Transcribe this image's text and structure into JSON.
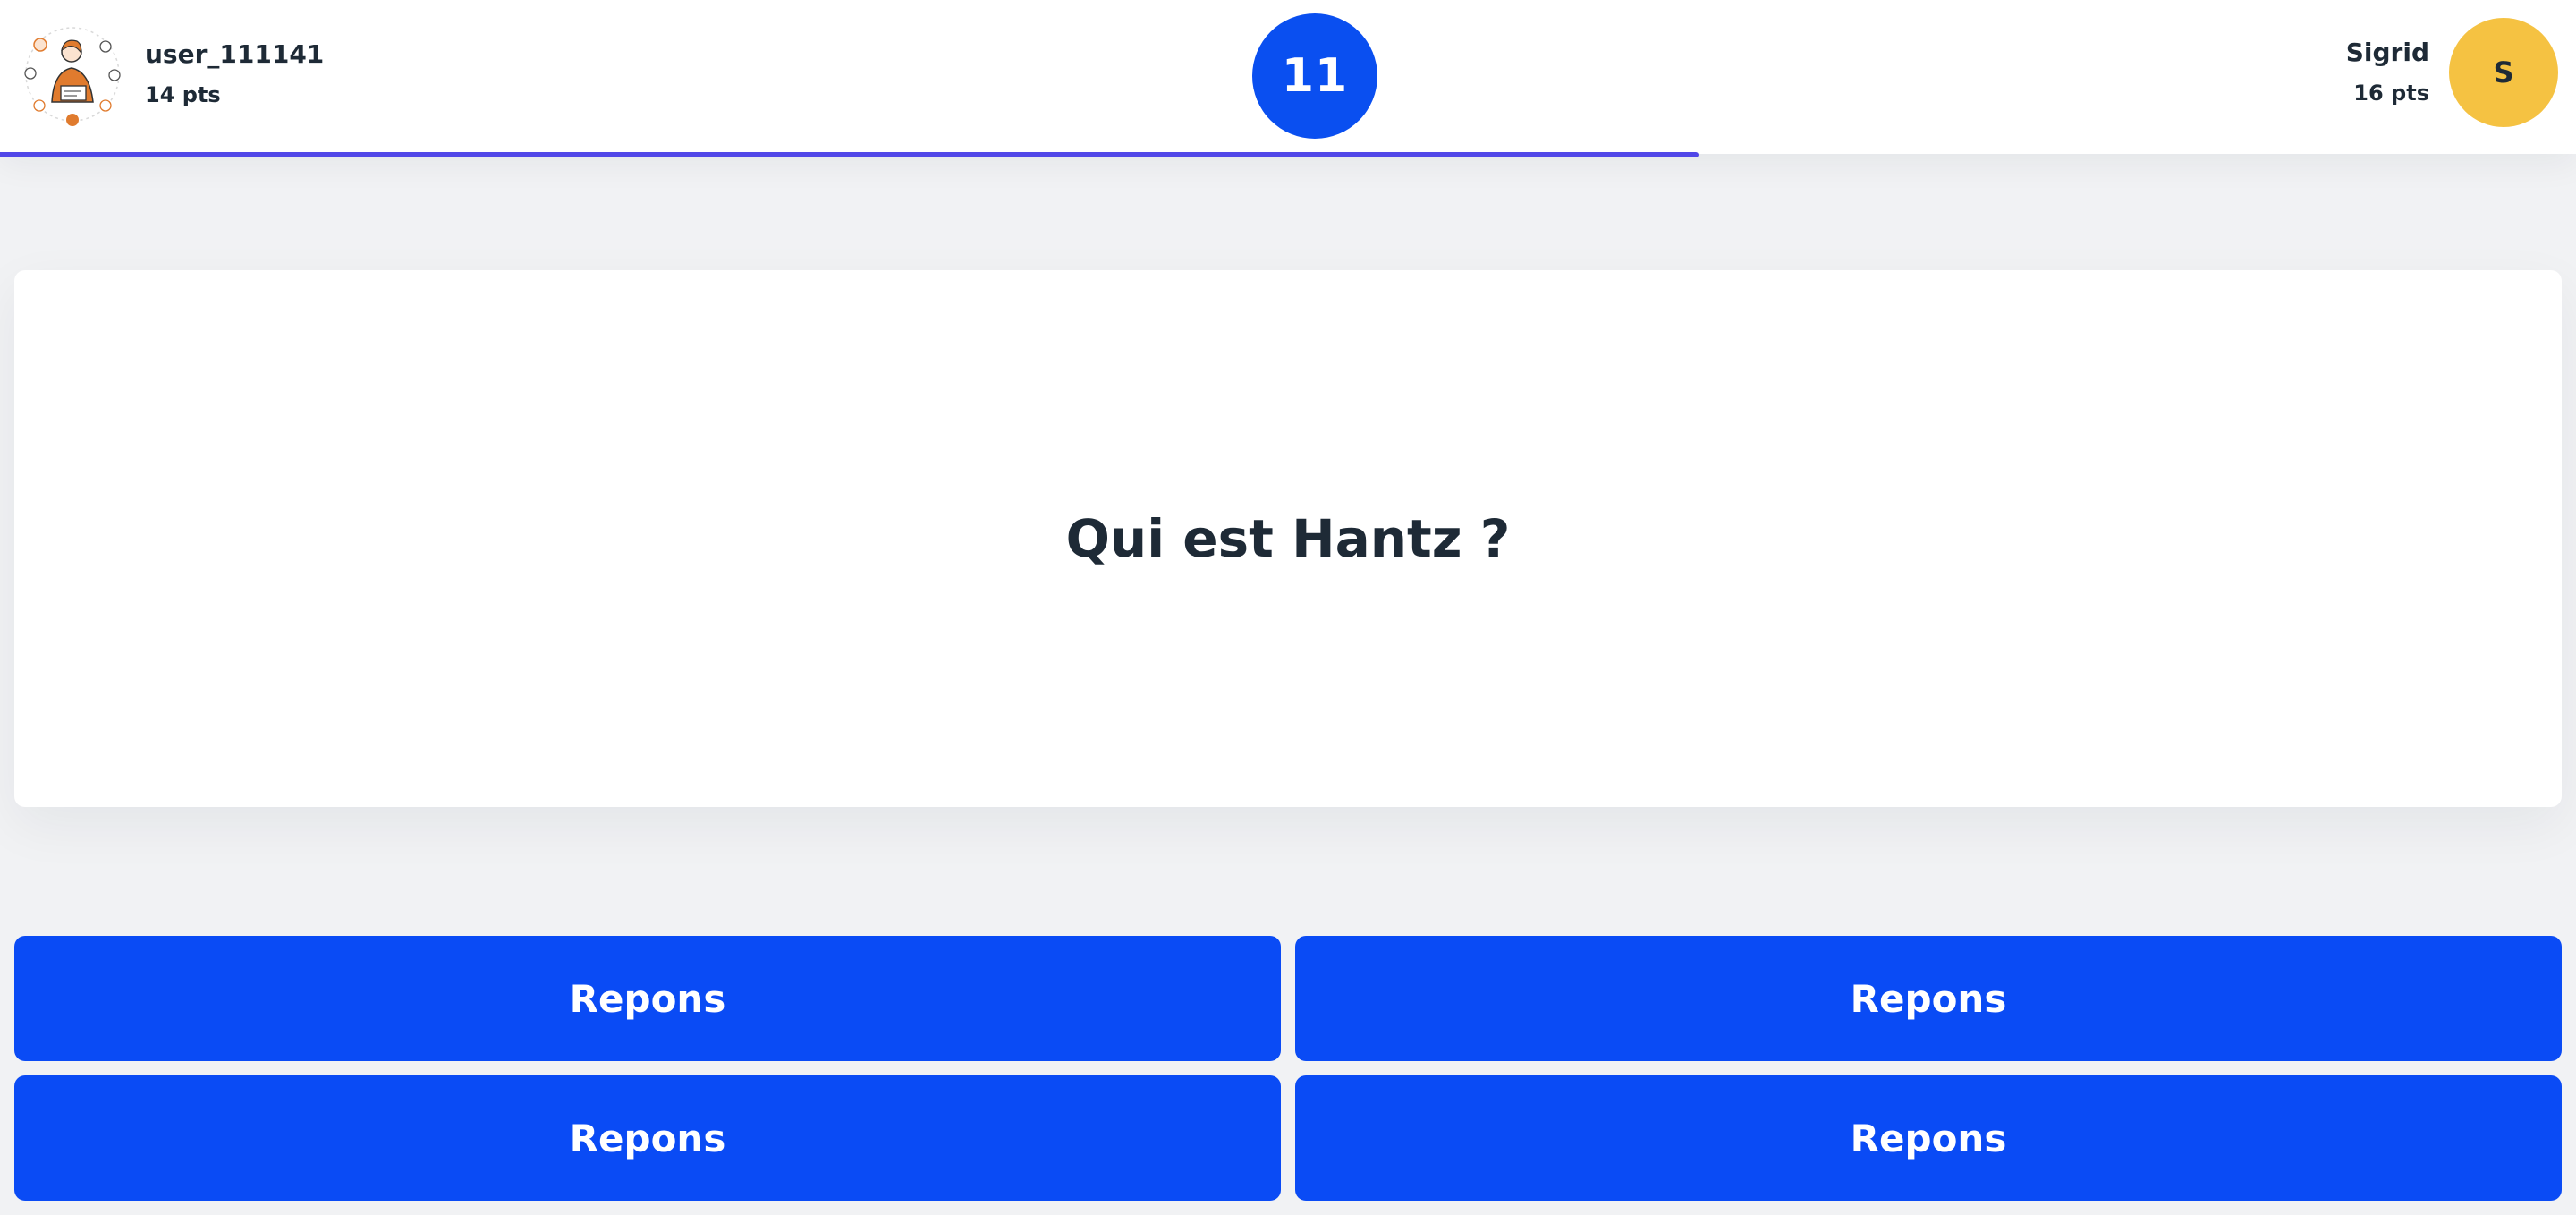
{
  "player_left": {
    "name": "user_111141",
    "score": "14 pts",
    "avatar": "user-illustration-avatar"
  },
  "timer": {
    "value": "11",
    "color": "#0a4ff0"
  },
  "player_right": {
    "name": "Sigrid",
    "score": "16 pts",
    "avatar_letter": "S",
    "avatar_color": "#f5c242"
  },
  "progress": {
    "fraction": 0.6594,
    "color": "#5147e8"
  },
  "question": {
    "text": "Qui est Hantz ?"
  },
  "answers": [
    {
      "label": "Repons"
    },
    {
      "label": "Repons"
    },
    {
      "label": "Repons"
    },
    {
      "label": "Repons"
    }
  ],
  "colors": {
    "answer_bg": "#0a4bf5",
    "page_bg": "#f1f2f4"
  }
}
